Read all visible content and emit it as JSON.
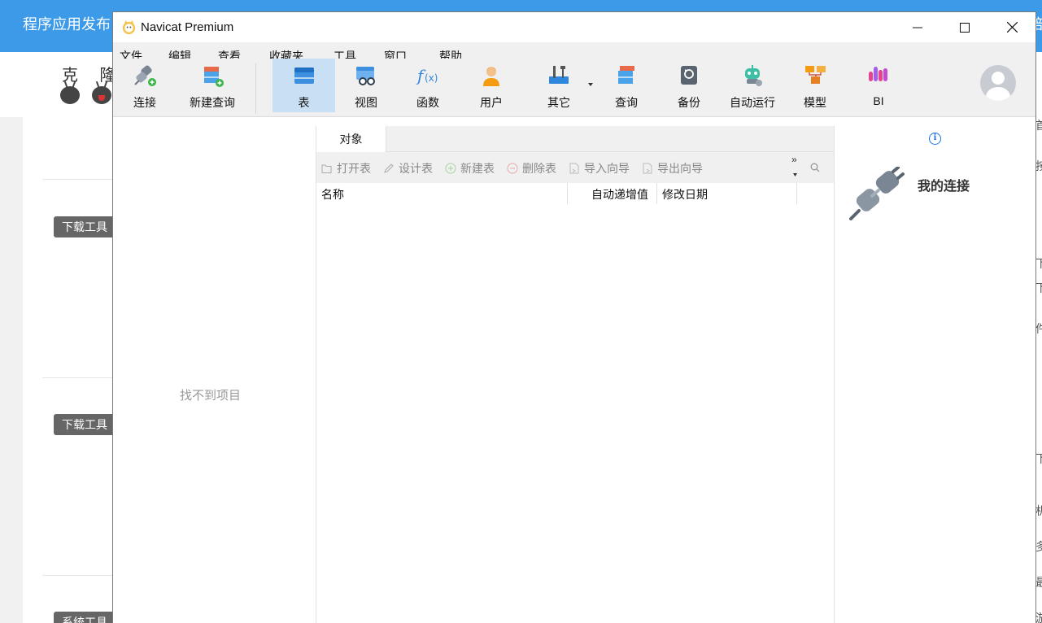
{
  "background_page": {
    "header_title": "程序应用发布",
    "header_right_fragment": "部",
    "brand": "克 隆",
    "tags": [
      "下载工具",
      "下载工具",
      "系统工具"
    ],
    "right_strip_chars": [
      "首",
      "按",
      "下",
      "下",
      "件",
      "下",
      "机",
      "多",
      "最",
      "游"
    ]
  },
  "window": {
    "title": "Navicat Premium",
    "controls": {
      "minimize": "—",
      "maximize": "☐",
      "close": "✕"
    }
  },
  "menu": [
    "文件",
    "编辑",
    "查看",
    "收藏夹",
    "工具",
    "窗口",
    "帮助"
  ],
  "toolbar": {
    "connect": "连接",
    "new_query": "新建查询",
    "table": "表",
    "view": "视图",
    "function": "函数",
    "user": "用户",
    "other": "其它",
    "query": "查询",
    "backup": "备份",
    "auto_run": "自动运行",
    "model": "模型",
    "bi": "BI"
  },
  "left_pane": {
    "empty_message": "找不到项目"
  },
  "tabs": {
    "objects": "对象"
  },
  "object_toolbar": {
    "open_table": "打开表",
    "design_table": "设计表",
    "new_table": "新建表",
    "delete_table": "删除表",
    "import_wizard": "导入向导",
    "export_wizard": "导出向导",
    "more": "»"
  },
  "grid": {
    "columns": [
      "名称",
      "自动递增值",
      "修改日期"
    ]
  },
  "right_pane": {
    "title": "我的连接",
    "info": "i"
  },
  "colors": {
    "accent": "#3c9ae8",
    "active_tool": "#c9dff3",
    "window_bg": "#f0f0f0"
  }
}
